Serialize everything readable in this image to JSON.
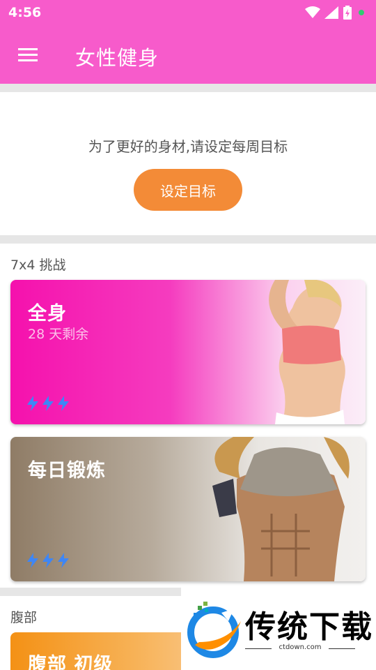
{
  "status_bar": {
    "time": "4:56"
  },
  "app_bar": {
    "title": "女性健身"
  },
  "goal": {
    "prompt": "为了更好的身材,请设定每周目标",
    "button_label": "设定目标"
  },
  "challenge": {
    "section_title": "7x4 挑战",
    "cards": [
      {
        "title": "全身",
        "subtitle": "28 天剩余",
        "difficulty": 3
      },
      {
        "title": "每日锻炼",
        "difficulty": 3
      }
    ]
  },
  "abs": {
    "section_title": "腹部",
    "cards": [
      {
        "title": "腹部 初级"
      }
    ]
  },
  "watermark": {
    "name": "传统下载",
    "url": "ctdown.com"
  },
  "colors": {
    "primary": "#f75bcb",
    "accent": "#f38b37",
    "bolt": "#3e86f5"
  }
}
